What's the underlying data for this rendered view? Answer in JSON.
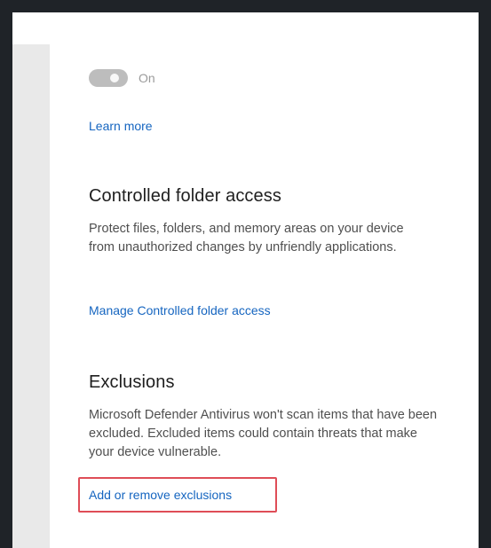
{
  "toggle": {
    "state_label": "On",
    "enabled": true
  },
  "links": {
    "learn_more": "Learn more",
    "manage_controlled_folder_access": "Manage Controlled folder access",
    "add_or_remove_exclusions": "Add or remove exclusions"
  },
  "sections": {
    "controlled_folder_access": {
      "title": "Controlled folder access",
      "description": "Protect files, folders, and memory areas on your device from unauthorized changes by unfriendly applications."
    },
    "exclusions": {
      "title": "Exclusions",
      "description": "Microsoft Defender Antivirus won't scan items that have been excluded. Excluded items could contain threats that make your device vulnerable."
    }
  },
  "colors": {
    "background": "#1f2328",
    "panel": "#ffffff",
    "sidebar": "#e9e9e9",
    "link": "#1565c0",
    "highlight": "#df4d57",
    "toggle": "#bdbdbd"
  }
}
